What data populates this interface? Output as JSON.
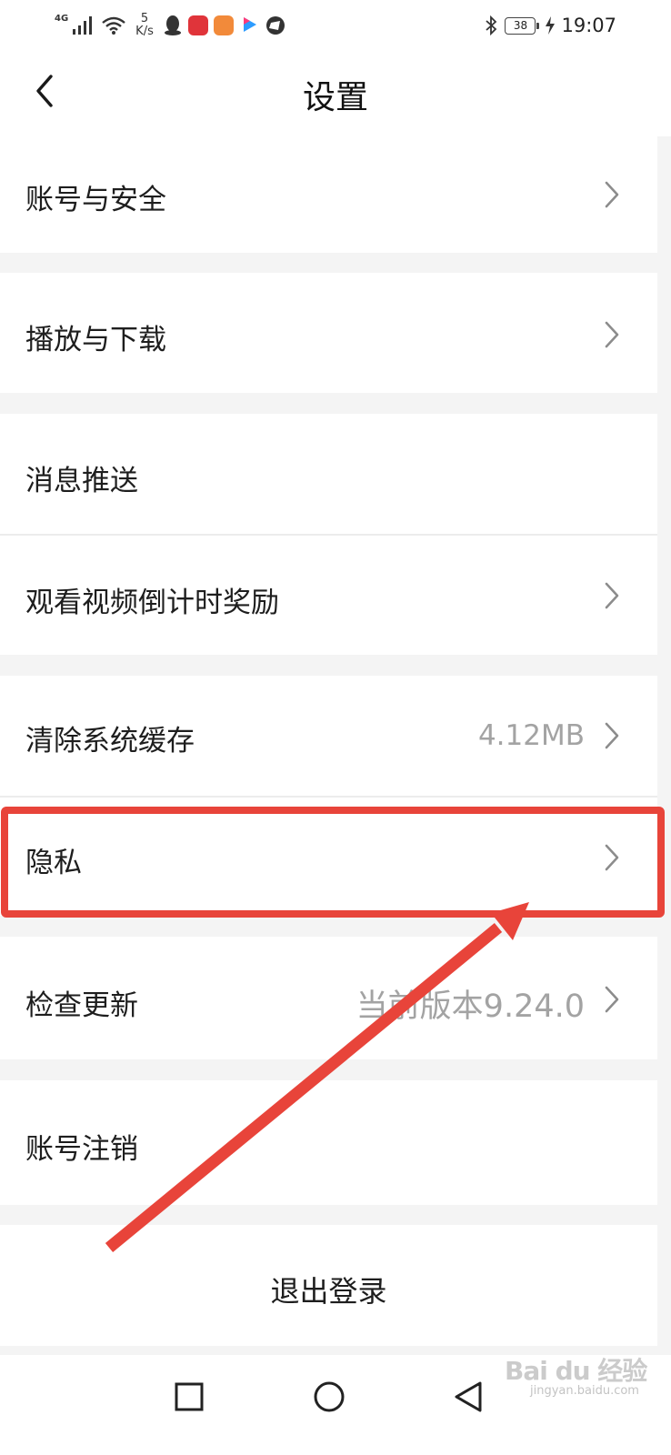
{
  "status_bar": {
    "network": "4G",
    "speed_value": "5",
    "speed_unit": "K/s",
    "battery": "38",
    "time": "19:07",
    "icons": [
      "signal-icon",
      "wifi-icon",
      "qq-icon",
      "huawei-app-icon",
      "health-app-icon",
      "youku-icon",
      "browser-icon",
      "bluetooth-icon",
      "battery-icon",
      "charging-icon"
    ]
  },
  "header": {
    "title": "设置",
    "back_icon": "chevron-left-icon"
  },
  "settings": {
    "items": [
      {
        "label": "账号与安全"
      },
      {
        "label": "播放与下载"
      },
      {
        "label": "消息推送"
      },
      {
        "label": "观看视频倒计时奖励"
      },
      {
        "label": "清除系统缓存",
        "value": "4.12MB"
      },
      {
        "label": "隐私"
      },
      {
        "label": "检查更新",
        "value": "当前版本9.24.0"
      },
      {
        "label": "账号注销"
      }
    ],
    "logout_label": "退出登录"
  },
  "bottom_nav": {
    "icons": [
      "square-recents-icon",
      "circle-home-icon",
      "triangle-back-icon"
    ]
  },
  "watermark": {
    "main": "Bai du 经验",
    "sub": "jingyan.baidu.com"
  },
  "colors": {
    "highlight": "#e8443a",
    "background": "#f4f4f4",
    "value_text": "#a3a3a3"
  }
}
